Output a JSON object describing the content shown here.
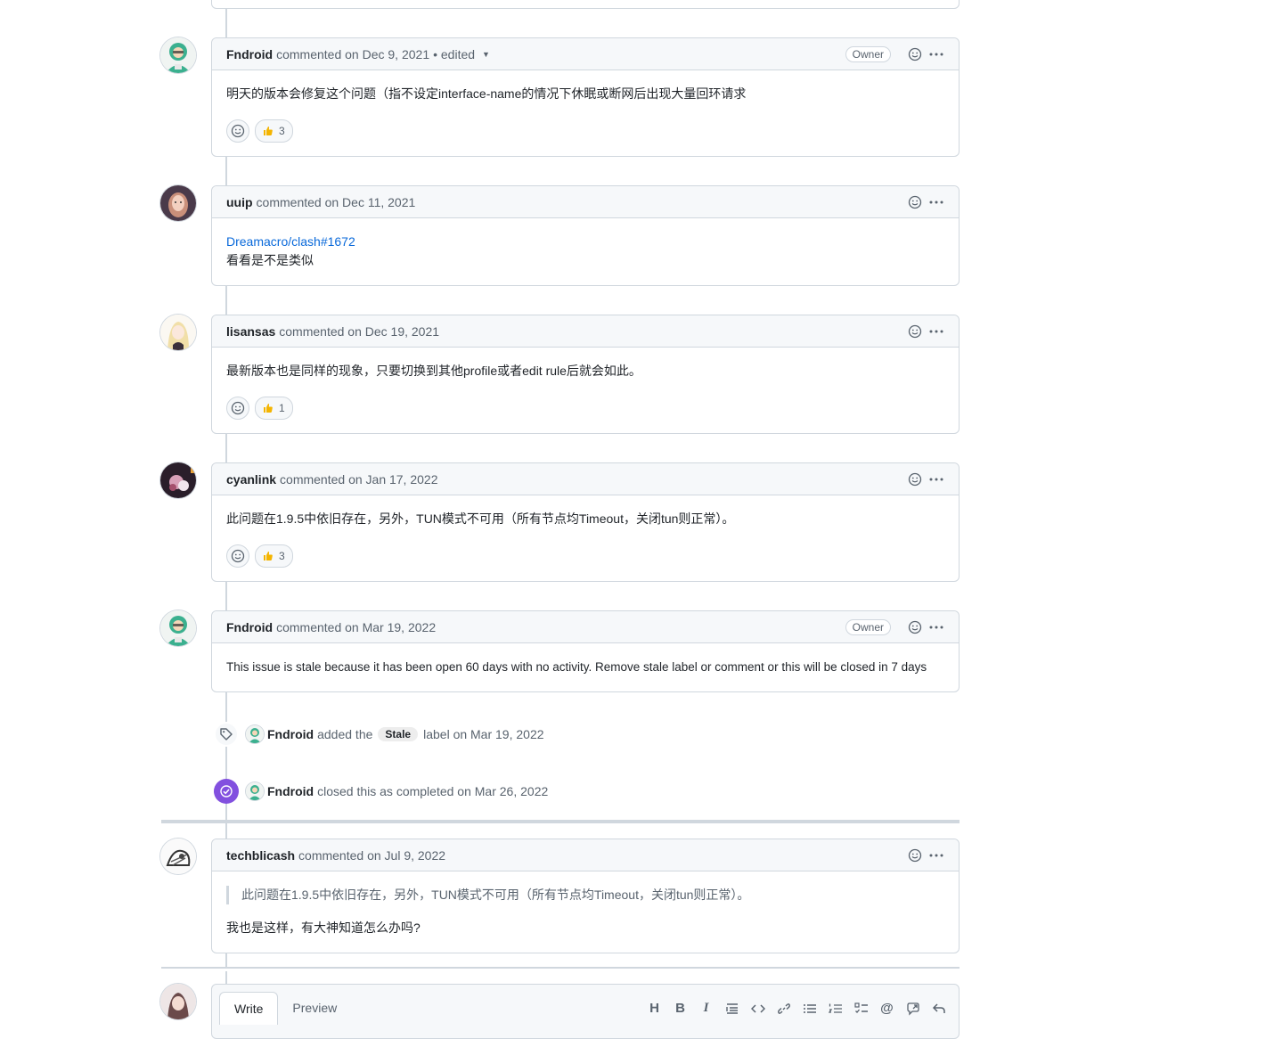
{
  "comments": [
    {
      "author": "Fndroid",
      "action": "commented on Dec 9, 2021",
      "edited": "• edited",
      "badge": "Owner",
      "body": "明天的版本会修复这个问题（指不设定interface-name的情况下休眠或断网后出现大量回环请求",
      "reaction_count": "3"
    },
    {
      "author": "uuip",
      "action": "commented on Dec 11, 2021",
      "link": "Dreamacro/clash#1672",
      "body": "看看是不是类似"
    },
    {
      "author": "lisansas",
      "action": "commented on Dec 19, 2021",
      "body": "最新版本也是同样的现象，只要切换到其他profile或者edit rule后就会如此。",
      "reaction_count": "1"
    },
    {
      "author": "cyanlink",
      "action": "commented on Jan 17, 2022",
      "body": "此问题在1.9.5中依旧存在，另外，TUN模式不可用（所有节点均Timeout，关闭tun则正常）。",
      "reaction_count": "3"
    },
    {
      "author": "Fndroid",
      "action": "commented on Mar 19, 2022",
      "badge": "Owner",
      "body": "This issue is stale because it has been open 60 days with no activity. Remove stale label or comment or this will be closed in 7 days"
    },
    {
      "author": "techblicash",
      "action": "commented on Jul 9, 2022",
      "quote": "此问题在1.9.5中依旧存在，另外，TUN模式不可用（所有节点均Timeout，关闭tun则正常）。",
      "body": "我也是这样，有大神知道怎么办吗?"
    }
  ],
  "events": {
    "label": {
      "author": "Fndroid",
      "pre": "added the",
      "label": "Stale",
      "post": "label on Mar 19, 2022"
    },
    "closed": {
      "author": "Fndroid",
      "text": "closed this as completed on Mar 26, 2022"
    }
  },
  "editor": {
    "tab_write": "Write",
    "tab_preview": "Preview",
    "tools": [
      "heading-icon",
      "bold-icon",
      "italic-icon",
      "quote-icon",
      "code-icon",
      "link-icon",
      "bulleted-list-icon",
      "numbered-list-icon",
      "task-list-icon",
      "mention-icon",
      "cross-reference-icon",
      "reply-icon"
    ]
  },
  "colors": {
    "accent_link": "#0969da",
    "closed_purple": "#8250df",
    "border": "#d0d7de",
    "header_bg": "#f6f8fa"
  }
}
